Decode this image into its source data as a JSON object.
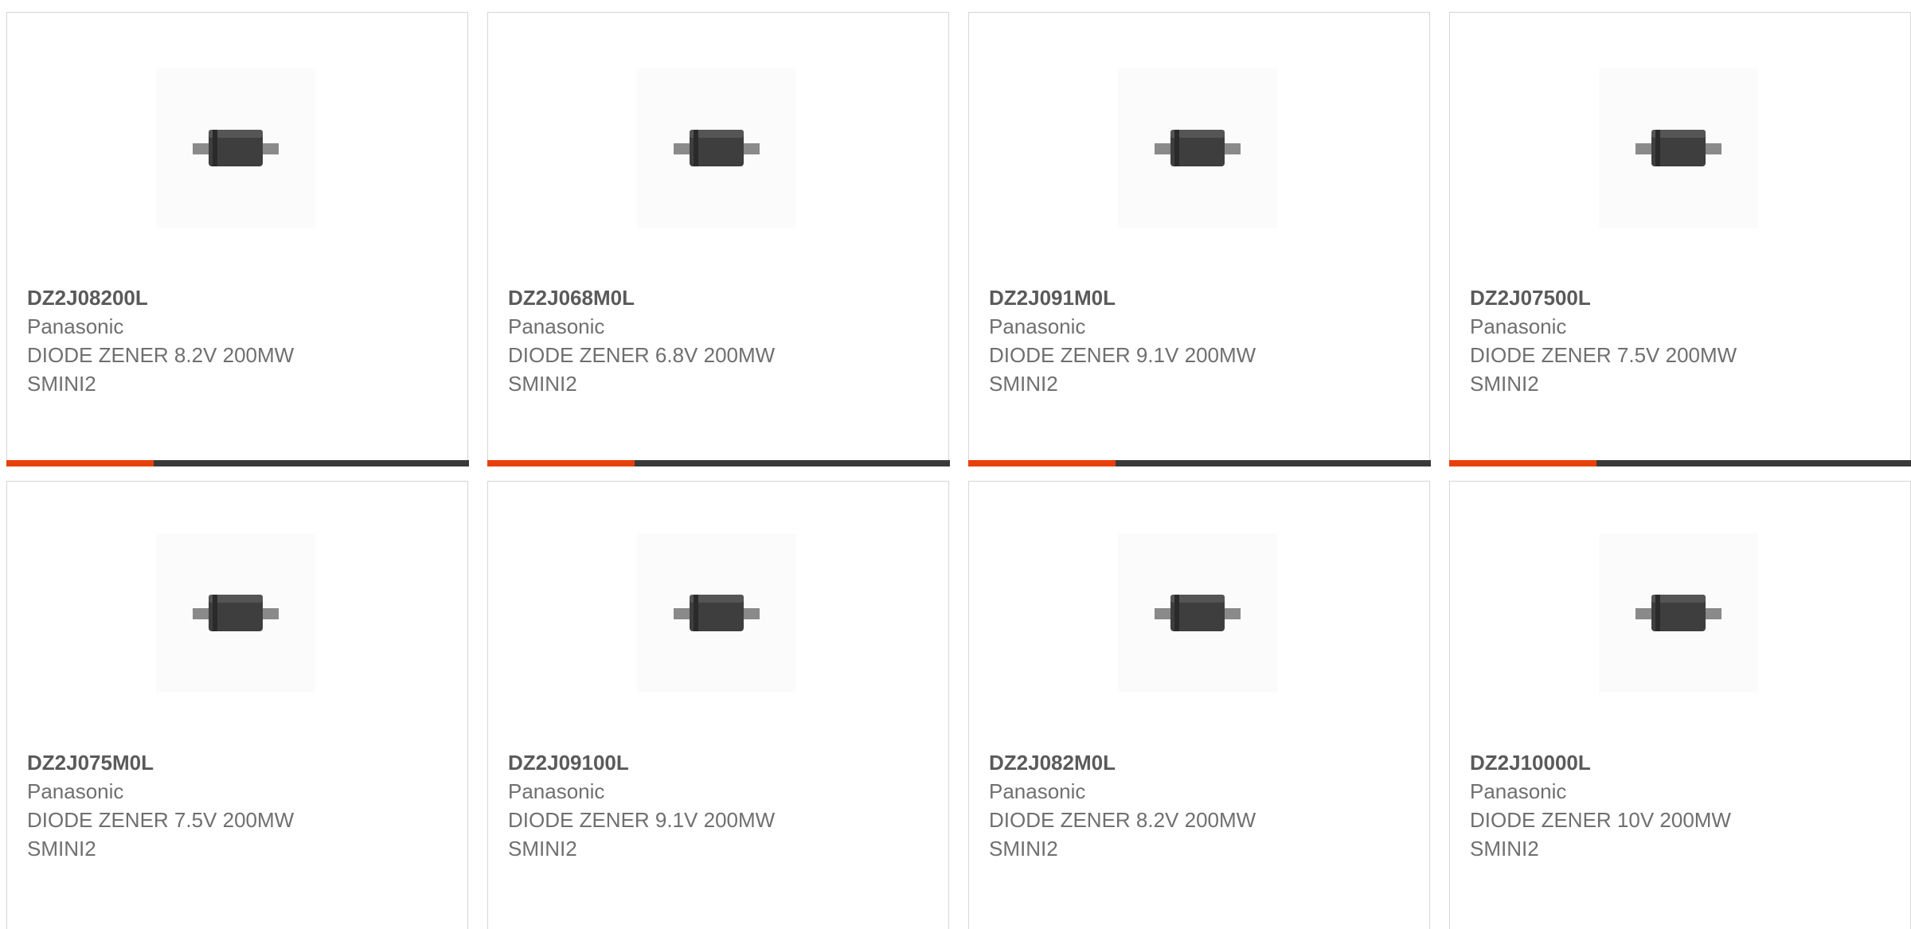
{
  "colors": {
    "accent": "#e8400c",
    "bar": "#3a3a3a"
  },
  "products": [
    {
      "part_number": "DZ2J08200L",
      "manufacturer": "Panasonic",
      "description": "DIODE ZENER 8.2V 200MW",
      "package": "SMINI2"
    },
    {
      "part_number": "DZ2J068M0L",
      "manufacturer": "Panasonic",
      "description": "DIODE ZENER 6.8V 200MW",
      "package": "SMINI2"
    },
    {
      "part_number": "DZ2J091M0L",
      "manufacturer": "Panasonic",
      "description": "DIODE ZENER 9.1V 200MW",
      "package": "SMINI2"
    },
    {
      "part_number": "DZ2J07500L",
      "manufacturer": "Panasonic",
      "description": "DIODE ZENER 7.5V 200MW",
      "package": "SMINI2"
    },
    {
      "part_number": "DZ2J075M0L",
      "manufacturer": "Panasonic",
      "description": "DIODE ZENER 7.5V 200MW",
      "package": "SMINI2"
    },
    {
      "part_number": "DZ2J09100L",
      "manufacturer": "Panasonic",
      "description": "DIODE ZENER 9.1V 200MW",
      "package": "SMINI2"
    },
    {
      "part_number": "DZ2J082M0L",
      "manufacturer": "Panasonic",
      "description": "DIODE ZENER 8.2V 200MW",
      "package": "SMINI2"
    },
    {
      "part_number": "DZ2J10000L",
      "manufacturer": "Panasonic",
      "description": "DIODE ZENER 10V 200MW",
      "package": "SMINI2"
    }
  ]
}
